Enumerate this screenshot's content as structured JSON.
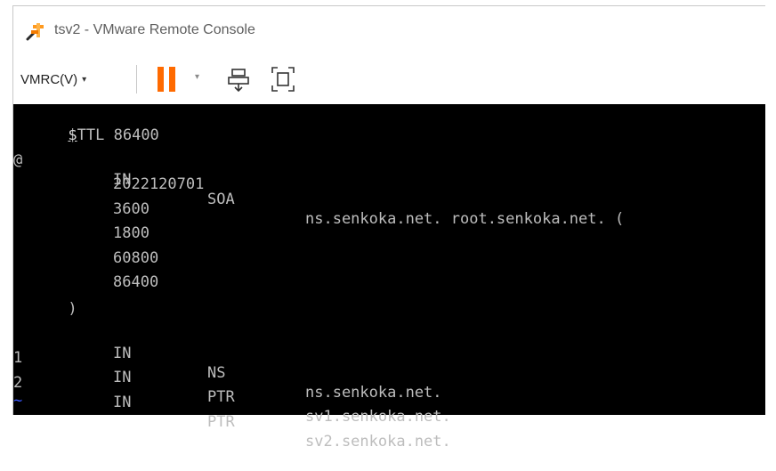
{
  "window": {
    "title": "tsv2 - VMware Remote Console"
  },
  "toolbar": {
    "menu_label": "VMRC(V)",
    "caret": "▾",
    "pause_caret": "▾"
  },
  "console": {
    "ttl_cursor_char": "$",
    "ttl_rest": "TTL 86400",
    "soa": {
      "name": "@",
      "class": "IN",
      "type": "SOA",
      "data": "ns.senkoka.net. root.senkoka.net. ("
    },
    "serial": "2022120701",
    "refresh": "3600",
    "retry": "1800",
    "expire": "60800",
    "minimum": "86400",
    "close_paren": ")",
    "records": [
      {
        "name": "",
        "class": "IN",
        "type": "NS",
        "data": "ns.senkoka.net."
      },
      {
        "name": "1",
        "class": "IN",
        "type": "PTR",
        "data": "sv1.senkoka.net."
      },
      {
        "name": "2",
        "class": "IN",
        "type": "PTR",
        "data": "sv2.senkoka.net."
      }
    ],
    "empty_line_marker": "~"
  },
  "colors": {
    "pause_icon": "#ff6a00",
    "console_bg": "#000000",
    "console_text": "#bdbdbd",
    "tilde": "#3a58ff"
  }
}
